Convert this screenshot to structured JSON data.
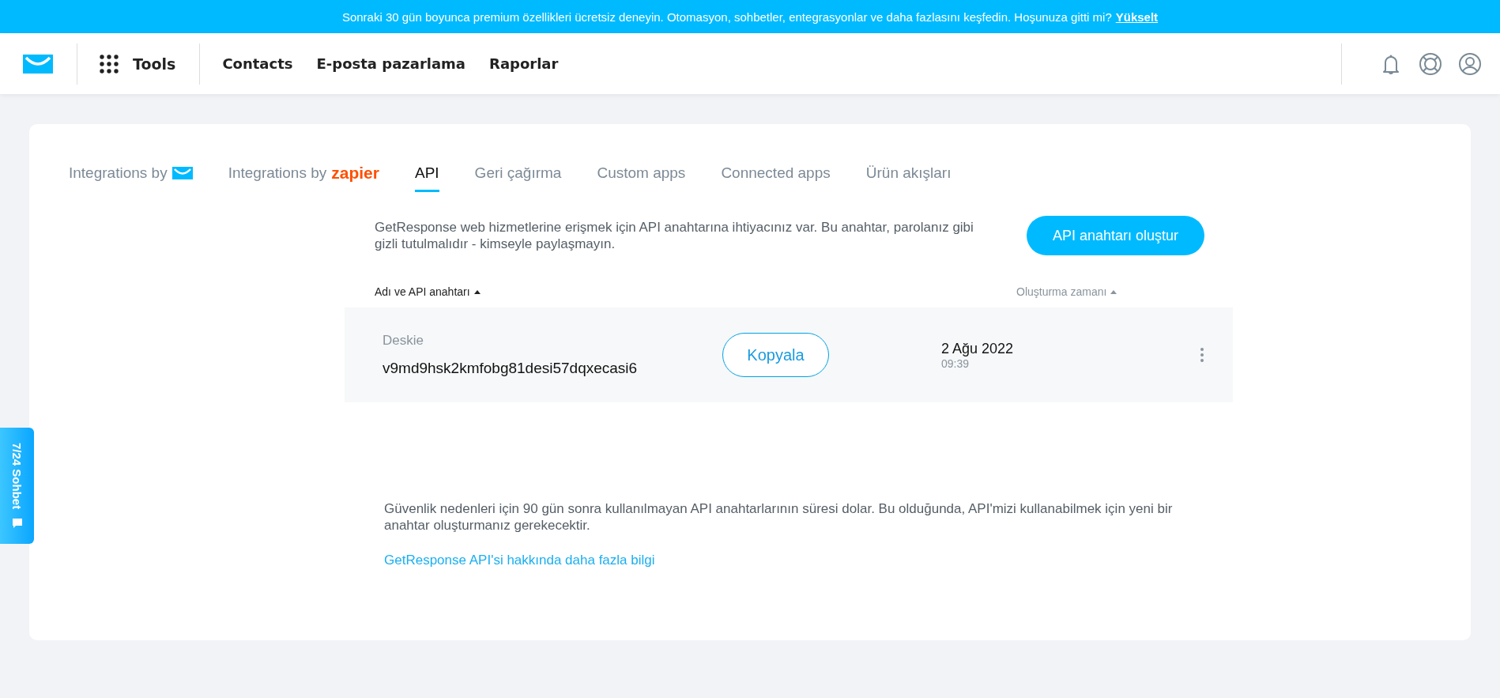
{
  "banner": {
    "text": "Sonraki 30 gün boyunca premium özellikleri ücretsiz deneyin. Otomasyon, sohbetler, entegrasyonlar ve daha fazlasını keşfedin. Hoşunuza gitti mi?",
    "link": "Yükselt"
  },
  "nav": {
    "tools": "Tools",
    "items": [
      "Contacts",
      "E-posta pazarlama",
      "Raporlar"
    ]
  },
  "tabs": [
    {
      "label": "Integrations by",
      "kind": "logo",
      "selected": false
    },
    {
      "label": "Integrations by",
      "kind": "brand",
      "brand": "zapier",
      "selected": false
    },
    {
      "label": "API",
      "kind": "plain",
      "selected": true
    },
    {
      "label": "Geri çağırma",
      "kind": "plain",
      "selected": false
    },
    {
      "label": "Custom apps",
      "kind": "plain",
      "selected": false
    },
    {
      "label": "Connected apps",
      "kind": "plain",
      "selected": false
    },
    {
      "label": "Ürün akışları",
      "kind": "plain",
      "selected": false
    }
  ],
  "intro": "GetResponse web hizmetlerine erişmek için API anahtarına ihtiyacınız var. Bu anahtar, parolanız gibi gizli tutulmalıdır - kimseyle paylaşmayın.",
  "create_button": "API anahtarı oluştur",
  "table": {
    "columns": [
      "Adı ve API anahtarı",
      "Oluşturma zamanı"
    ],
    "rows": [
      {
        "name": "Deskie",
        "key": "v9md9hsk2kmfobg81desi57dqxecasi6",
        "copy": "Kopyala",
        "date": "2 Ağu 2022",
        "time": "09:39"
      }
    ]
  },
  "note": "Güvenlik nedenleri için 90 gün sonra kullanılmayan API anahtarlarının süresi dolar. Bu olduğunda, API'mizi kullanabilmek için yeni bir anahtar oluşturmanız gerekecektir.",
  "more_link": "GetResponse API'si hakkında daha fazla bilgi",
  "chat_tab": "7/24 Sohbet"
}
